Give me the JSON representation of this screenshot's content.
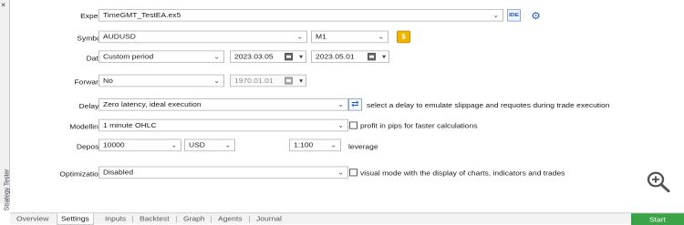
{
  "sidebar": {
    "close_glyph": "×",
    "title": "Strategy Tester"
  },
  "form": {
    "expert": {
      "label": "Expert:",
      "value": "TimeGMT_TestEA.ex5",
      "ide_label": "IDE"
    },
    "symbol": {
      "label": "Symbol:",
      "value": "AUDUSD",
      "timeframe": "M1",
      "currency_icon": "$"
    },
    "date": {
      "label": "Date:",
      "period": "Custom period",
      "from": "2023.03.05",
      "to": "2023.05.01"
    },
    "forward": {
      "label": "Forward:",
      "value": "No",
      "date": "1970.01.01"
    },
    "delays": {
      "label": "Delays:",
      "value": "Zero latency, ideal execution",
      "hint": "select a delay to emulate slippage and requotes during trade execution"
    },
    "modelling": {
      "label": "Modelling:",
      "value": "1 minute OHLC",
      "checkbox_label": "profit in pips for faster calculations"
    },
    "deposit": {
      "label": "Deposit:",
      "value": "10000",
      "currency": "USD",
      "leverage_value": "1:100",
      "leverage_label": "leverage"
    },
    "optimization": {
      "label": "Optimization:",
      "value": "Disabled",
      "checkbox_label": "visual mode with the display of charts, indicators and trades"
    }
  },
  "tabs": [
    "Overview",
    "Settings",
    "Inputs",
    "Backtest",
    "Graph",
    "Agents",
    "Journal"
  ],
  "active_tab": "Settings",
  "start_label": "Start",
  "icons": {
    "zoom": "zoom-in-icon",
    "gear": "gear-icon",
    "swap": "swap-icon",
    "dollar": "dollar-icon"
  },
  "colors": {
    "start": "#3aa346",
    "accent": "#2060c8"
  }
}
